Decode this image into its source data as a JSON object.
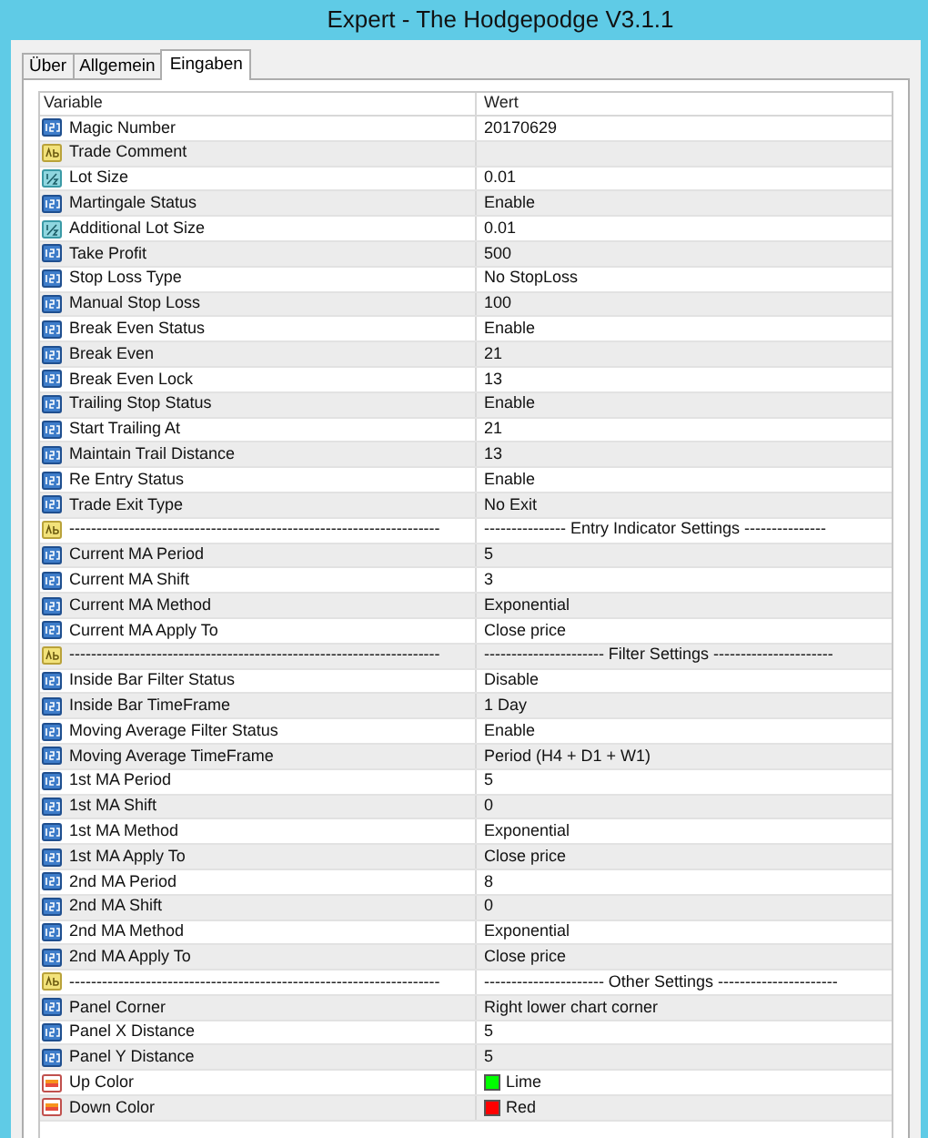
{
  "window": {
    "title": "Expert - The Hodgepodge V3.1.1"
  },
  "tabs": [
    {
      "label": "Über",
      "selected": false
    },
    {
      "label": "Allgemein",
      "selected": false
    },
    {
      "label": "Eingaben",
      "selected": true
    }
  ],
  "table": {
    "columns": [
      "Variable",
      "Wert"
    ],
    "rows": [
      {
        "kind": "int",
        "variable": "Magic Number",
        "value": "20170629"
      },
      {
        "kind": "string",
        "variable": "Trade Comment",
        "value": ""
      },
      {
        "kind": "double",
        "variable": "Lot Size",
        "value": "0.01"
      },
      {
        "kind": "int",
        "variable": "Martingale Status",
        "value": "Enable"
      },
      {
        "kind": "double",
        "variable": "Additional Lot Size",
        "value": "0.01"
      },
      {
        "kind": "int",
        "variable": "Take Profit",
        "value": "500"
      },
      {
        "kind": "int",
        "variable": "Stop Loss Type",
        "value": "No StopLoss"
      },
      {
        "kind": "int",
        "variable": "Manual Stop Loss",
        "value": "100"
      },
      {
        "kind": "int",
        "variable": "Break Even Status",
        "value": "Enable"
      },
      {
        "kind": "int",
        "variable": "Break Even",
        "value": "21"
      },
      {
        "kind": "int",
        "variable": "Break Even Lock",
        "value": "13"
      },
      {
        "kind": "int",
        "variable": "Trailing Stop Status",
        "value": "Enable"
      },
      {
        "kind": "int",
        "variable": "Start Trailing At",
        "value": "21"
      },
      {
        "kind": "int",
        "variable": "Maintain Trail Distance",
        "value": "13"
      },
      {
        "kind": "int",
        "variable": "Re Entry Status",
        "value": "Enable"
      },
      {
        "kind": "int",
        "variable": "Trade Exit Type",
        "value": "No Exit"
      },
      {
        "kind": "string",
        "variable": "--------------------------------------------------------------------",
        "value": "--------------- Entry Indicator Settings ---------------"
      },
      {
        "kind": "int",
        "variable": "Current MA Period",
        "value": "5"
      },
      {
        "kind": "int",
        "variable": "Current MA Shift",
        "value": "3"
      },
      {
        "kind": "int",
        "variable": "Current MA Method",
        "value": "Exponential"
      },
      {
        "kind": "int",
        "variable": "Current MA Apply To",
        "value": "Close price"
      },
      {
        "kind": "string",
        "variable": "--------------------------------------------------------------------",
        "value": "---------------------- Filter Settings ----------------------"
      },
      {
        "kind": "int",
        "variable": "Inside Bar Filter Status",
        "value": "Disable"
      },
      {
        "kind": "int",
        "variable": "Inside Bar TimeFrame",
        "value": "1 Day"
      },
      {
        "kind": "int",
        "variable": "Moving Average Filter Status",
        "value": "Enable"
      },
      {
        "kind": "int",
        "variable": "Moving Average TimeFrame",
        "value": "Period (H4 + D1 + W1)"
      },
      {
        "kind": "int",
        "variable": "1st MA Period",
        "value": "5"
      },
      {
        "kind": "int",
        "variable": "1st MA Shift",
        "value": "0"
      },
      {
        "kind": "int",
        "variable": "1st MA Method",
        "value": "Exponential"
      },
      {
        "kind": "int",
        "variable": "1st MA Apply To",
        "value": "Close price"
      },
      {
        "kind": "int",
        "variable": "2nd MA Period",
        "value": "8"
      },
      {
        "kind": "int",
        "variable": "2nd MA Shift",
        "value": "0"
      },
      {
        "kind": "int",
        "variable": "2nd MA Method",
        "value": "Exponential"
      },
      {
        "kind": "int",
        "variable": "2nd MA Apply To",
        "value": "Close price"
      },
      {
        "kind": "string",
        "variable": "--------------------------------------------------------------------",
        "value": "---------------------- Other Settings ----------------------"
      },
      {
        "kind": "int",
        "variable": "Panel Corner",
        "value": "Right lower chart corner"
      },
      {
        "kind": "int",
        "variable": "Panel X Distance",
        "value": "5"
      },
      {
        "kind": "int",
        "variable": "Panel Y Distance",
        "value": "5"
      },
      {
        "kind": "color",
        "variable": "Up Color",
        "value": "Lime",
        "color": "#00ff00"
      },
      {
        "kind": "color",
        "variable": "Down Color",
        "value": "Red",
        "color": "#ff0000"
      }
    ]
  }
}
